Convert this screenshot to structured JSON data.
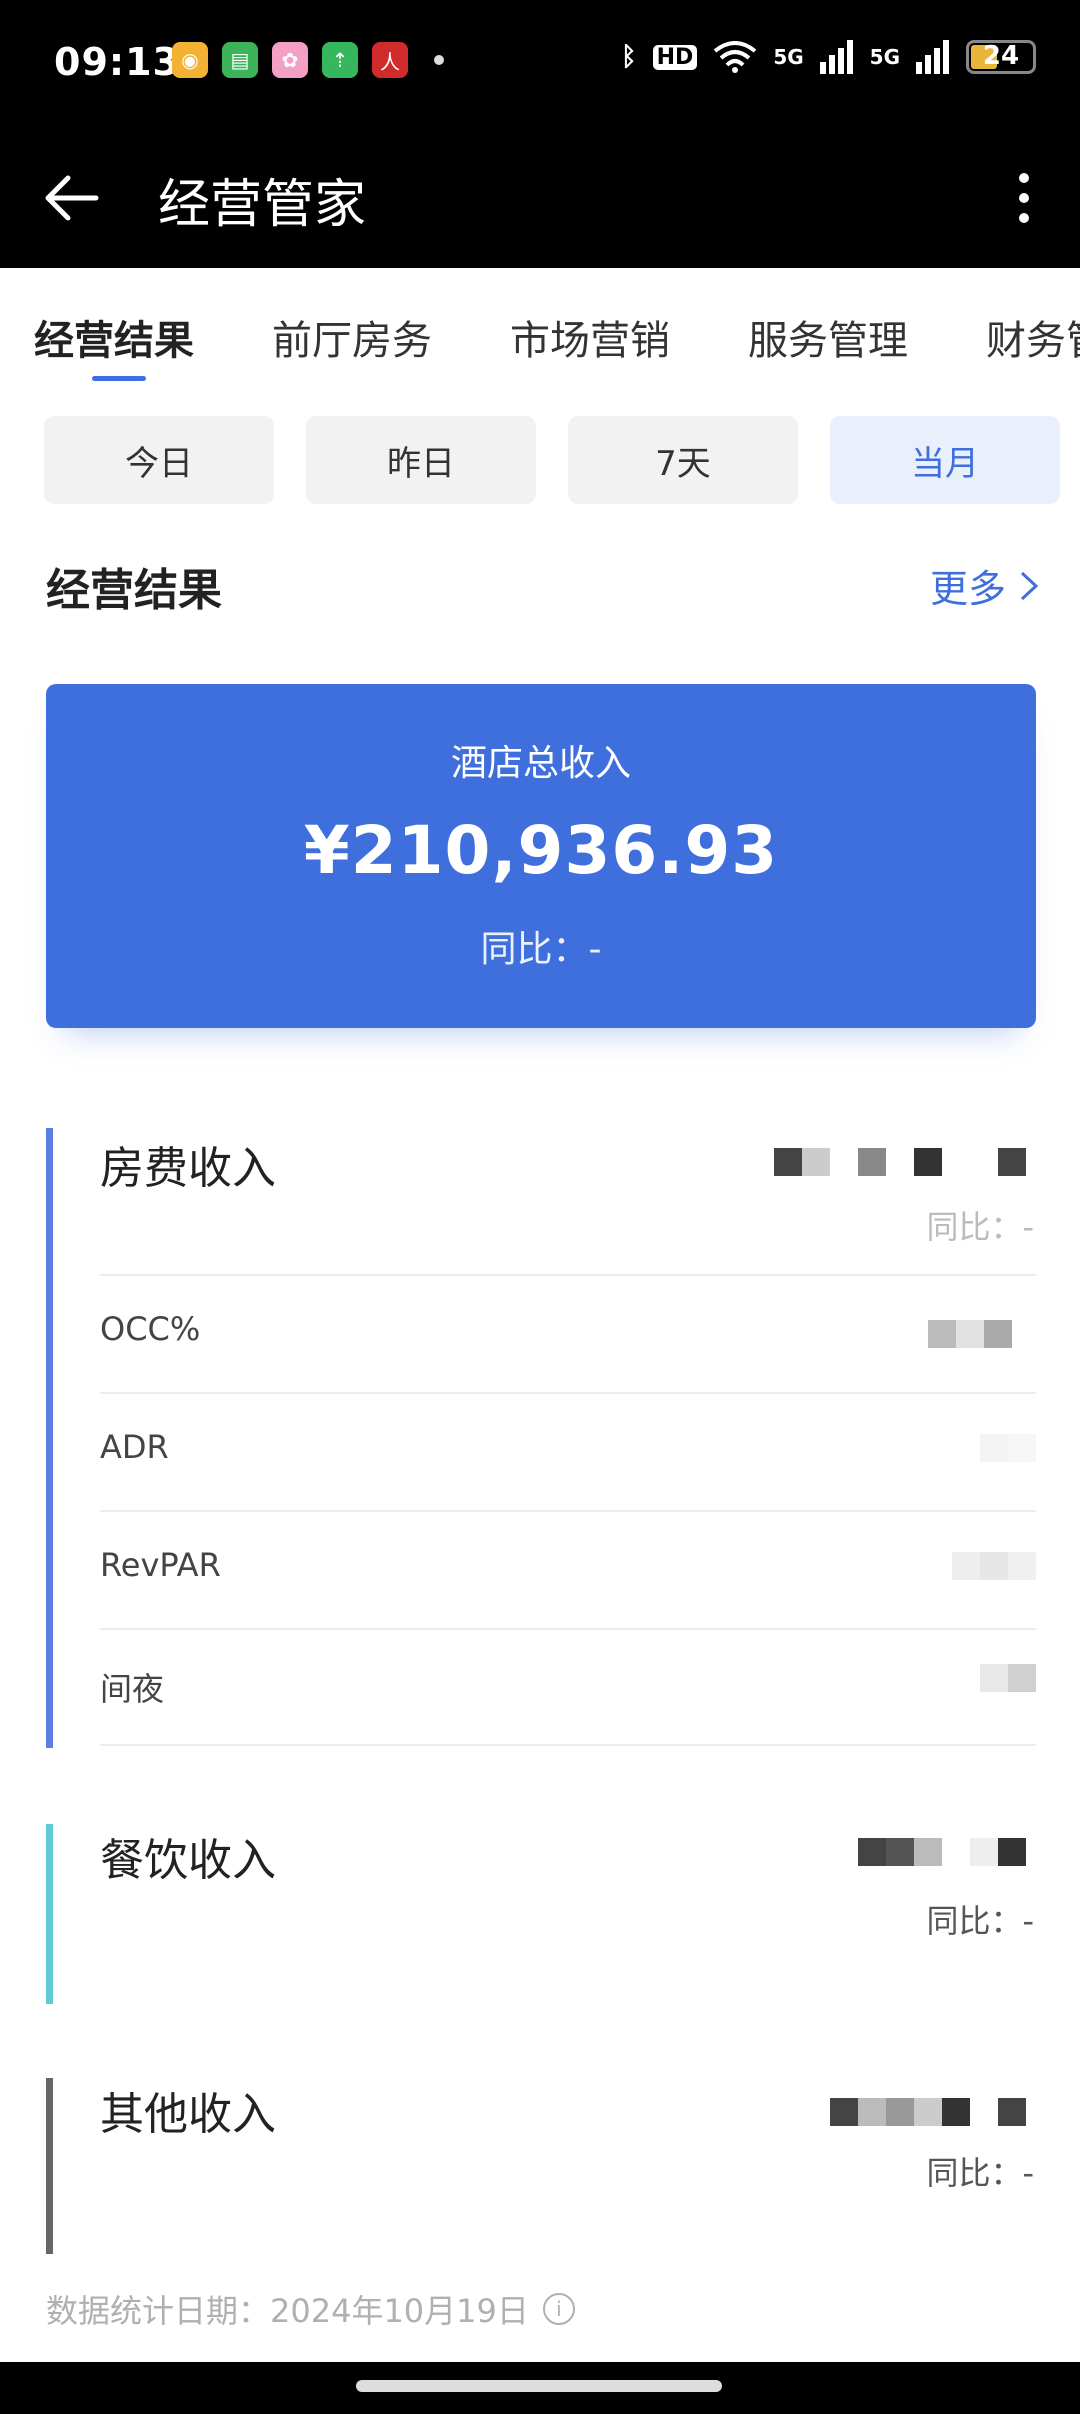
{
  "status_bar": {
    "time": "09:13",
    "network_badge": "HD",
    "signal_1": "5G",
    "signal_2": "5G",
    "battery": "24",
    "app_icons": [
      "weibo-icon",
      "messages-icon",
      "flower-app-icon",
      "upload-app-icon",
      "people-daily-icon"
    ]
  },
  "app_bar": {
    "title": "经营管家"
  },
  "tabs": [
    "经营结果",
    "前厅房务",
    "市场营销",
    "服务管理",
    "财务管"
  ],
  "date_filters": {
    "items": [
      "今日",
      "昨日",
      "7天",
      "当月"
    ],
    "selected": "当月"
  },
  "section": {
    "title": "经营结果",
    "more_label": "更多"
  },
  "total_card": {
    "label": "酒店总收入",
    "value": "¥210,936.93",
    "yoy": "同比：-"
  },
  "room_income": {
    "title": "房费收入",
    "yoy": "同比：-",
    "rows": [
      "OCC%",
      "ADR",
      "RevPAR",
      "间夜"
    ]
  },
  "food_income": {
    "title": "餐饮收入",
    "yoy": "同比：-"
  },
  "other_income": {
    "title": "其他收入",
    "yoy": "同比：-"
  },
  "footer": {
    "stat_date": "数据统计日期：2024年10月19日"
  },
  "colors": {
    "accent": "#3f6fdc",
    "room_bar": "#5b7fe0",
    "food_bar": "#5fc9d6",
    "other_bar": "#666666",
    "statusbar_bg": "#000000"
  }
}
